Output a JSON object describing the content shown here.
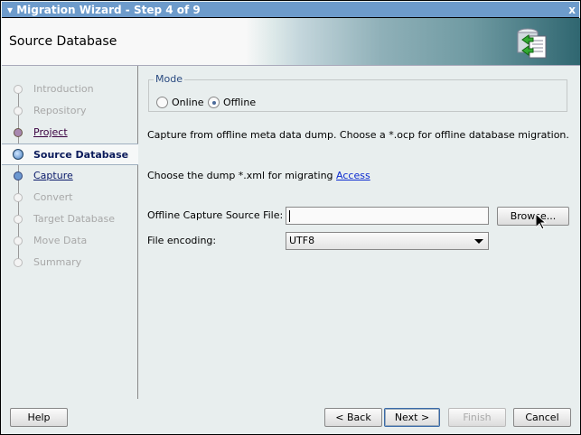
{
  "window": {
    "title": "Migration Wizard - Step 4 of 9",
    "close": "x"
  },
  "header": {
    "title": "Source Database"
  },
  "steps": [
    {
      "label": "Introduction",
      "state": "disabled"
    },
    {
      "label": "Repository",
      "state": "disabled"
    },
    {
      "label": "Project",
      "state": "visited"
    },
    {
      "label": "Source Database",
      "state": "current"
    },
    {
      "label": "Capture",
      "state": "next"
    },
    {
      "label": "Convert",
      "state": "disabled"
    },
    {
      "label": "Target Database",
      "state": "disabled"
    },
    {
      "label": "Move Data",
      "state": "disabled"
    },
    {
      "label": "Summary",
      "state": "disabled"
    }
  ],
  "main": {
    "mode_label": "Mode",
    "online": "Online",
    "offline": "Offline",
    "selected_mode": "Offline",
    "desc": "Capture from offline meta data dump.  Choose a *.ocp for offline database migration.",
    "dump_text": "Choose the dump *.xml for migrating",
    "dump_link": "Access",
    "source_file_label": "Offline Capture Source File:",
    "source_file_value": "",
    "browse": "Browse...",
    "encoding_label": "File encoding:",
    "encoding_value": "UTF8"
  },
  "footer": {
    "help": "Help",
    "back": "< Back",
    "next": "Next >",
    "finish": "Finish",
    "cancel": "Cancel"
  }
}
